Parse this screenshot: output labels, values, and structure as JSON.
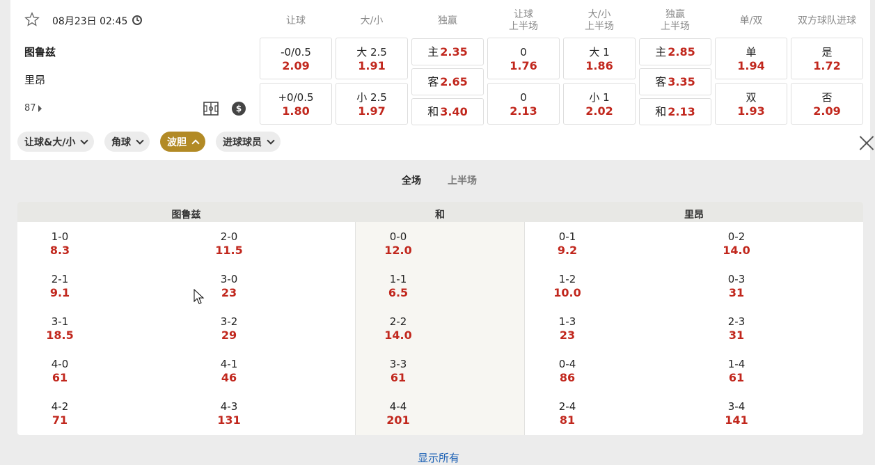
{
  "match": {
    "datetime": "08月23日 02:45",
    "home": "图鲁兹",
    "away": "里昂",
    "minute": "87"
  },
  "columns": [
    "让球",
    "大/小",
    "独赢",
    "让球\n上半场",
    "大/小\n上半场",
    "独赢\n上半场",
    "单/双",
    "双方球队进球"
  ],
  "odds": {
    "handicap": [
      {
        "label": "-0/0.5",
        "value": "2.09"
      },
      {
        "label": "+0/0.5",
        "value": "1.80"
      }
    ],
    "totals": [
      {
        "label": "大 2.5",
        "value": "1.91"
      },
      {
        "label": "小 2.5",
        "value": "1.97"
      }
    ],
    "moneyline": [
      {
        "label": "主",
        "value": "2.35"
      },
      {
        "label": "客",
        "value": "2.65"
      },
      {
        "label": "和",
        "value": "3.40"
      }
    ],
    "handicap_1h": [
      {
        "label": "0",
        "value": "1.76"
      },
      {
        "label": "0",
        "value": "2.13"
      }
    ],
    "totals_1h": [
      {
        "label": "大 1",
        "value": "1.86"
      },
      {
        "label": "小 1",
        "value": "2.02"
      }
    ],
    "moneyline_1h": [
      {
        "label": "主",
        "value": "2.85"
      },
      {
        "label": "客",
        "value": "3.35"
      },
      {
        "label": "和",
        "value": "2.13"
      }
    ],
    "odd_even": [
      {
        "label": "单",
        "value": "1.94"
      },
      {
        "label": "双",
        "value": "1.93"
      }
    ],
    "btts": [
      {
        "label": "是",
        "value": "1.72"
      },
      {
        "label": "否",
        "value": "2.09"
      }
    ]
  },
  "chips": [
    {
      "label": "让球&大/小",
      "active": false
    },
    {
      "label": "角球",
      "active": false
    },
    {
      "label": "波胆",
      "active": true
    },
    {
      "label": "进球球员",
      "active": false
    }
  ],
  "period_tabs": [
    "全场",
    "上半场"
  ],
  "grid_heads": [
    "图鲁兹",
    "和",
    "里昂"
  ],
  "correct_score": [
    [
      {
        "s": "1-0",
        "o": "8.3"
      },
      {
        "s": "2-0",
        "o": "11.5"
      },
      {
        "s": "0-0",
        "o": "12.0"
      },
      {
        "s": "0-1",
        "o": "9.2"
      },
      {
        "s": "0-2",
        "o": "14.0"
      }
    ],
    [
      {
        "s": "2-1",
        "o": "9.1"
      },
      {
        "s": "3-0",
        "o": "23"
      },
      {
        "s": "1-1",
        "o": "6.5"
      },
      {
        "s": "1-2",
        "o": "10.0"
      },
      {
        "s": "0-3",
        "o": "31"
      }
    ],
    [
      {
        "s": "3-1",
        "o": "18.5"
      },
      {
        "s": "3-2",
        "o": "29"
      },
      {
        "s": "2-2",
        "o": "14.0"
      },
      {
        "s": "1-3",
        "o": "23"
      },
      {
        "s": "2-3",
        "o": "31"
      }
    ],
    [
      {
        "s": "4-0",
        "o": "61"
      },
      {
        "s": "4-1",
        "o": "46"
      },
      {
        "s": "3-3",
        "o": "61"
      },
      {
        "s": "0-4",
        "o": "86"
      },
      {
        "s": "1-4",
        "o": "61"
      }
    ],
    [
      {
        "s": "4-2",
        "o": "71"
      },
      {
        "s": "4-3",
        "o": "131"
      },
      {
        "s": "4-4",
        "o": "201"
      },
      {
        "s": "2-4",
        "o": "81"
      },
      {
        "s": "3-4",
        "o": "141"
      }
    ]
  ],
  "show_all": "显示所有"
}
